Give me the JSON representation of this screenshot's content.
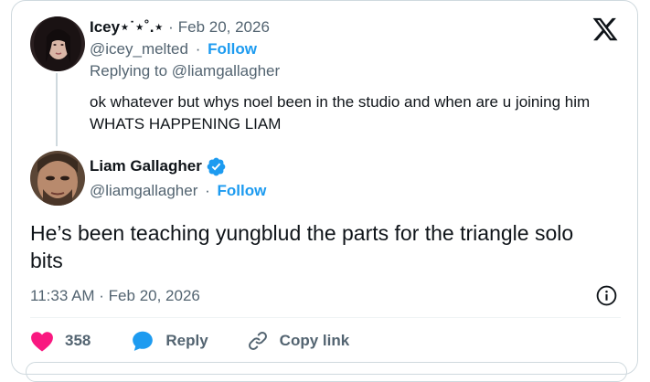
{
  "reply": {
    "display_name": "Icey⋆˙⋆˚.⋆",
    "separator": "·",
    "date": "Feb 20, 2026",
    "handle": "@icey_melted",
    "handle_separator": "·",
    "follow_label": "Follow",
    "replying_to": "Replying to @liamgallagher",
    "text": "ok whatever but whys noel been in the studio and when are u joining him WHATS HAPPENING LIAM"
  },
  "tweet": {
    "display_name": "Liam Gallagher",
    "handle": "@liamgallagher",
    "handle_separator": "·",
    "follow_label": "Follow",
    "text": "He’s been teaching yungblud the parts for the triangle solo bits",
    "timestamp": "11:33 AM · Feb 20, 2026"
  },
  "actions": {
    "like_count": "358",
    "reply_label": "Reply",
    "copy_link_label": "Copy link"
  },
  "colors": {
    "accent": "#1d9bf0",
    "like": "#f91880",
    "muted": "#536471"
  },
  "icons": [
    "x-logo-icon",
    "verified-badge-icon",
    "info-icon",
    "heart-icon",
    "reply-bubble-icon",
    "link-icon"
  ]
}
